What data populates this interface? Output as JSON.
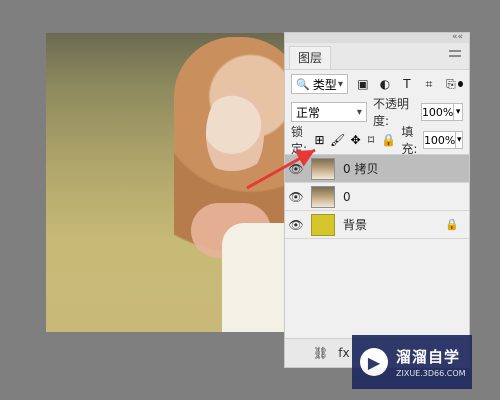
{
  "panel": {
    "tab_label": "图层",
    "filter_select": "类型",
    "blend_mode": "正常",
    "opacity_label": "不透明度:",
    "opacity_value": "100%",
    "lock_label": "锁定:",
    "fill_label": "填充:",
    "fill_value": "100%",
    "layers": [
      {
        "name": "0 拷贝",
        "visible": true,
        "selected": true
      },
      {
        "name": "0",
        "visible": true,
        "selected": false
      },
      {
        "name": "背景",
        "visible": true,
        "selected": false,
        "locked": true
      }
    ],
    "bottom_icons": [
      "link-icon",
      "fx-icon"
    ]
  },
  "icons": {
    "filter_search": "search-icon",
    "filter_pixel": "image-icon",
    "filter_adjust": "adjustment-icon",
    "filter_type": "text-icon",
    "filter_shape": "shape-icon",
    "filter_smart": "smart-object-icon",
    "lock_transparent": "transparent-lock-icon",
    "lock_pixels": "brush-icon",
    "lock_position": "move-icon",
    "lock_artboard": "artboard-icon",
    "lock_all": "lock-icon",
    "eye": "eye-icon"
  },
  "colors": {
    "arrow": "#e53935",
    "background_layer_thumb": "#d4c62c"
  },
  "watermark": {
    "brand_cn": "溜溜自学",
    "brand_en": "ZIXUE.3D66.COM"
  }
}
